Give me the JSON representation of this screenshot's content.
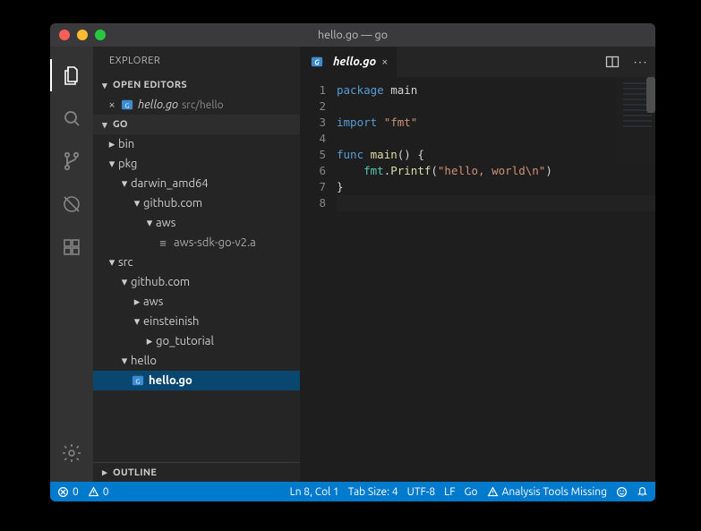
{
  "titlebar": {
    "title": "hello.go — go"
  },
  "sidebar": {
    "title": "EXPLORER",
    "sections": {
      "open_editors": {
        "label": "OPEN EDITORS",
        "items": [
          {
            "file": "hello.go",
            "path": "src/hello"
          }
        ]
      },
      "workspace": {
        "label": "GO",
        "tree": {
          "bin": {
            "name": "bin"
          },
          "pkg": {
            "name": "pkg"
          },
          "darwin": {
            "name": "darwin_amd64"
          },
          "gh1": {
            "name": "github.com"
          },
          "aws1": {
            "name": "aws"
          },
          "awsfile": {
            "name": "aws-sdk-go-v2.a"
          },
          "src": {
            "name": "src"
          },
          "gh2": {
            "name": "github.com"
          },
          "aws2": {
            "name": "aws"
          },
          "einst": {
            "name": "einsteinish"
          },
          "gotut": {
            "name": "go_tutorial"
          },
          "hello": {
            "name": "hello"
          },
          "hellogo": {
            "name": "hello.go"
          }
        }
      },
      "outline": {
        "label": "OUTLINE"
      }
    }
  },
  "tabs": {
    "active": {
      "label": "hello.go"
    }
  },
  "code": {
    "line1_kw": "package",
    "line1_id": "main",
    "line3_kw": "import",
    "line3_str": "\"fmt\"",
    "line5_kw": "func",
    "line5_fn": "main",
    "line5_rest": "() {",
    "line6_pkg": "fmt",
    "line6_dot": ".",
    "line6_fn": "Printf",
    "line6_paren_open": "(",
    "line6_str": "\"hello, world\\n\"",
    "line6_paren_close": ")",
    "line7": "}",
    "gutter": [
      "1",
      "2",
      "3",
      "4",
      "5",
      "6",
      "7",
      "8"
    ]
  },
  "status": {
    "errors": "0",
    "warnings": "0",
    "cursor": "Ln 8, Col 1",
    "tab_size": "Tab Size: 4",
    "encoding": "UTF-8",
    "eol": "LF",
    "language": "Go",
    "message": "Analysis Tools Missing"
  }
}
